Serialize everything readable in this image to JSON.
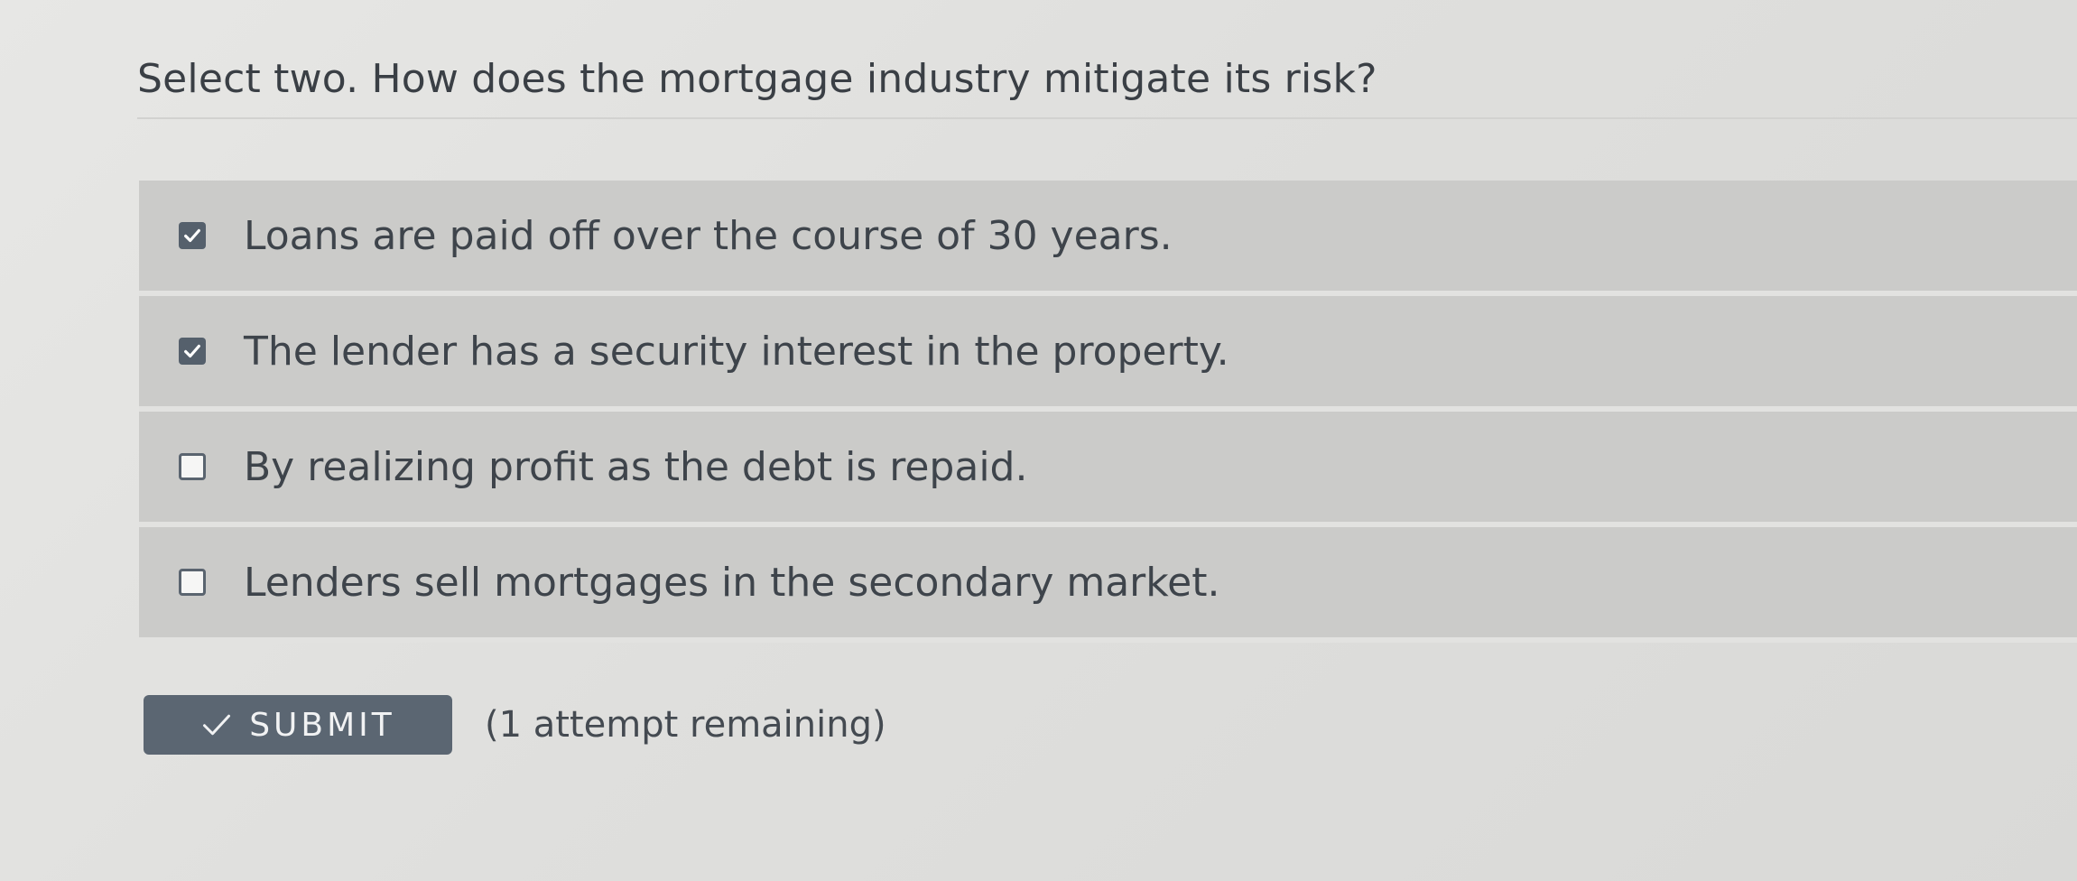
{
  "question": {
    "text": "Select two. How does the mortgage industry mitigate its risk?"
  },
  "options": [
    {
      "label": "Loans are paid off over the course of 30 years.",
      "checked": true
    },
    {
      "label": "The lender has a security interest in the property.",
      "checked": true
    },
    {
      "label": "By realizing profit as the debt is repaid.",
      "checked": false
    },
    {
      "label": "Lenders sell mortgages in the secondary market.",
      "checked": false
    }
  ],
  "submit": {
    "label": "SUBMIT",
    "icon": "check-icon"
  },
  "attempts_text": "(1 attempt remaining)",
  "colors": {
    "checkbox_checked": "#55606c",
    "submit_background": "#5b6672",
    "option_background": "#cbcbc9"
  }
}
